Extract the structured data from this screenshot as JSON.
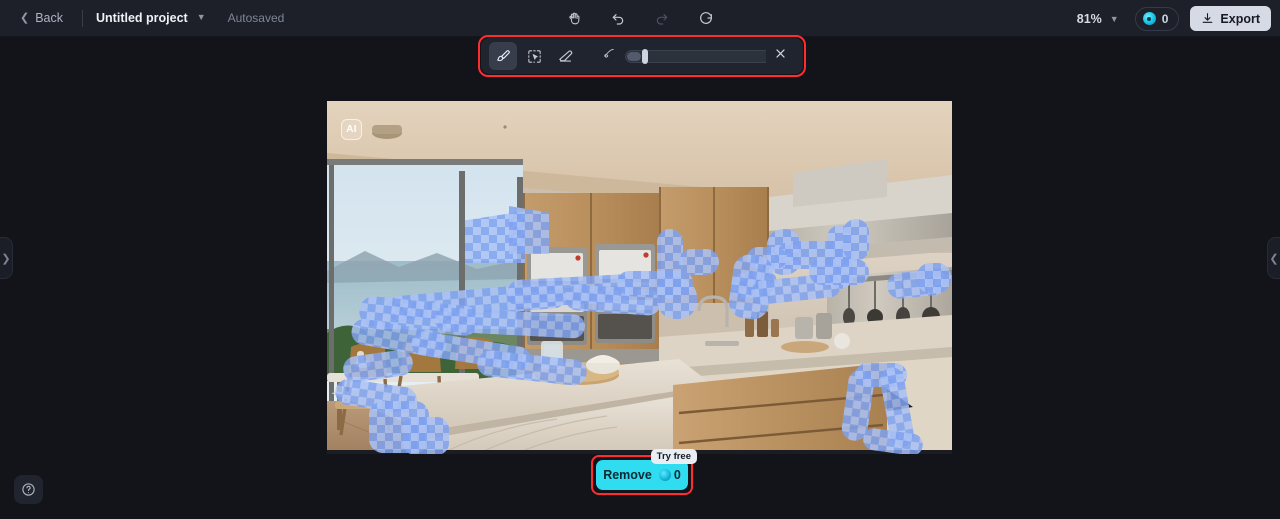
{
  "header": {
    "back_label": "Back",
    "back_icon": "chevron-left-icon",
    "project_name": "Untitled project",
    "project_caret_icon": "chevron-down-icon",
    "autosave_status": "Autosaved",
    "tools": [
      {
        "name": "hand-tool-icon",
        "title": "Hand"
      },
      {
        "name": "undo-icon",
        "title": "Undo"
      },
      {
        "name": "redo-icon",
        "title": "Redo"
      },
      {
        "name": "reset-icon",
        "title": "Reset"
      }
    ],
    "zoom_level": "81%",
    "zoom_caret_icon": "chevron-down-icon",
    "credits_icon": "credit-coin-icon",
    "credits_count": "0",
    "export_label": "Export",
    "export_icon": "download-icon"
  },
  "toolbar": {
    "brush_icon": "brush-icon",
    "object_select_icon": "object-select-icon",
    "eraser_icon": "eraser-icon",
    "brush_small_icon": "brush-size-small-icon",
    "brush_large_icon": "brush-size-large-icon",
    "brush_size_percent": 10,
    "close_icon": "close-icon"
  },
  "canvas": {
    "ai_badge": "AI",
    "image_alt": "Modern kitchen interior with wooden cabinetry, marble island, ocean view window and blue brush mask selection"
  },
  "panels": {
    "left_handle_icon": "chevron-right-icon",
    "right_handle_icon": "chevron-left-icon"
  },
  "footer": {
    "help_icon": "help-circle-icon",
    "remove_label": "Remove",
    "remove_cost": "0",
    "remove_cost_icon": "credit-coin-icon",
    "try_free_label": "Try free"
  },
  "colors": {
    "accent": "#2fdcf0",
    "header_bg": "#1d2029",
    "canvas_bg": "#12141a",
    "mask_blue": "#7fa2f0",
    "highlight_outline": "#ff2d2d",
    "export_bg": "#d6dae4"
  }
}
